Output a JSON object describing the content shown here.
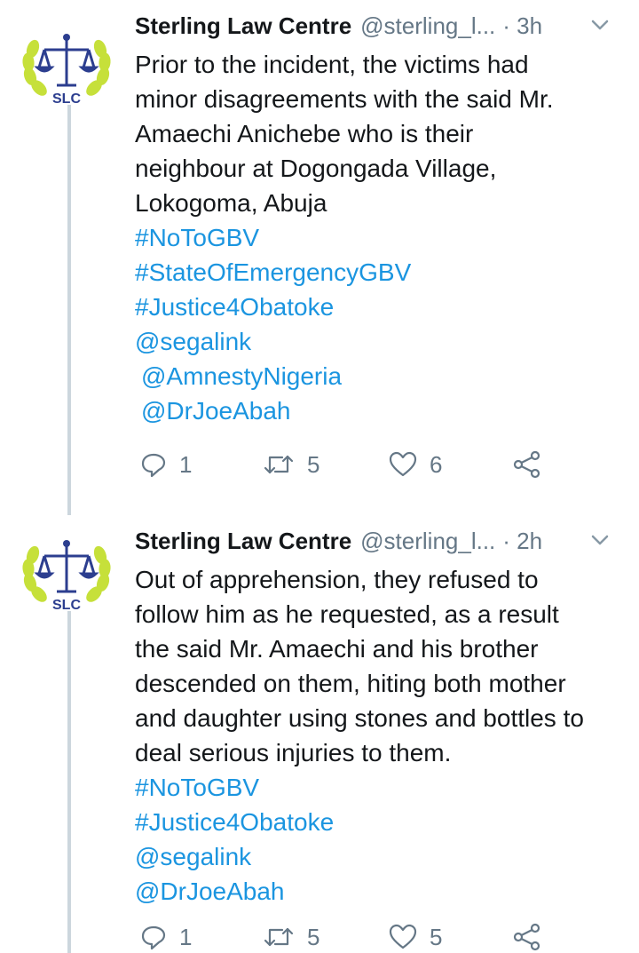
{
  "tweets": [
    {
      "author": {
        "name": "Sterling Law Centre",
        "handle": "@sterling_l...",
        "logo_text": "SLC"
      },
      "time": "· 3h",
      "lines": [
        {
          "text": "Prior to the incident, the victims had",
          "type": "text"
        },
        {
          "text": "minor disagreements with the said Mr.",
          "type": "text"
        },
        {
          "text": "Amaechi Anichebe who is their",
          "type": "text"
        },
        {
          "text": "neighbour at Dogongada Village,",
          "type": "text"
        },
        {
          "text": "Lokogoma, Abuja",
          "type": "text"
        },
        {
          "text": "#NoToGBV",
          "type": "link"
        },
        {
          "text": "#StateOfEmergencyGBV",
          "type": "link"
        },
        {
          "text": "#Justice4Obatoke",
          "type": "link"
        },
        {
          "text": "@segalink",
          "type": "link"
        },
        {
          "text": "@AmnestyNigeria",
          "type": "link"
        },
        {
          "text": "@DrJoeAbah",
          "type": "link"
        }
      ],
      "replies": "1",
      "retweets": "5",
      "likes": "6"
    },
    {
      "author": {
        "name": "Sterling Law Centre",
        "handle": "@sterling_l...",
        "logo_text": "SLC"
      },
      "time": "· 2h",
      "lines": [
        {
          "text": "Out of apprehension, they refused to",
          "type": "text"
        },
        {
          "text": "follow him as he requested, as a result",
          "type": "text"
        },
        {
          "text": "the said Mr. Amaechi and his brother",
          "type": "text"
        },
        {
          "text": "descended on them, hiting both mother",
          "type": "text"
        },
        {
          "text": "and daughter using stones and bottles to",
          "type": "text"
        },
        {
          "text": "deal serious injuries to them.",
          "type": "text"
        },
        {
          "text": "#NoToGBV",
          "type": "link"
        },
        {
          "text": "#Justice4Obatoke",
          "type": "link"
        },
        {
          "text": "@segalink",
          "type": "link"
        },
        {
          "text": "@DrJoeAbah",
          "type": "link"
        }
      ],
      "replies": "1",
      "retweets": "5",
      "likes": "5"
    }
  ],
  "colors": {
    "link": "#1b95e0",
    "secondary": "#657786",
    "logo_green": "#c6e03a",
    "logo_blue": "#2c3e8f"
  },
  "icons": [
    "reply-icon",
    "retweet-icon",
    "like-icon",
    "share-icon",
    "chevron-down-icon",
    "scales-of-justice-logo"
  ]
}
